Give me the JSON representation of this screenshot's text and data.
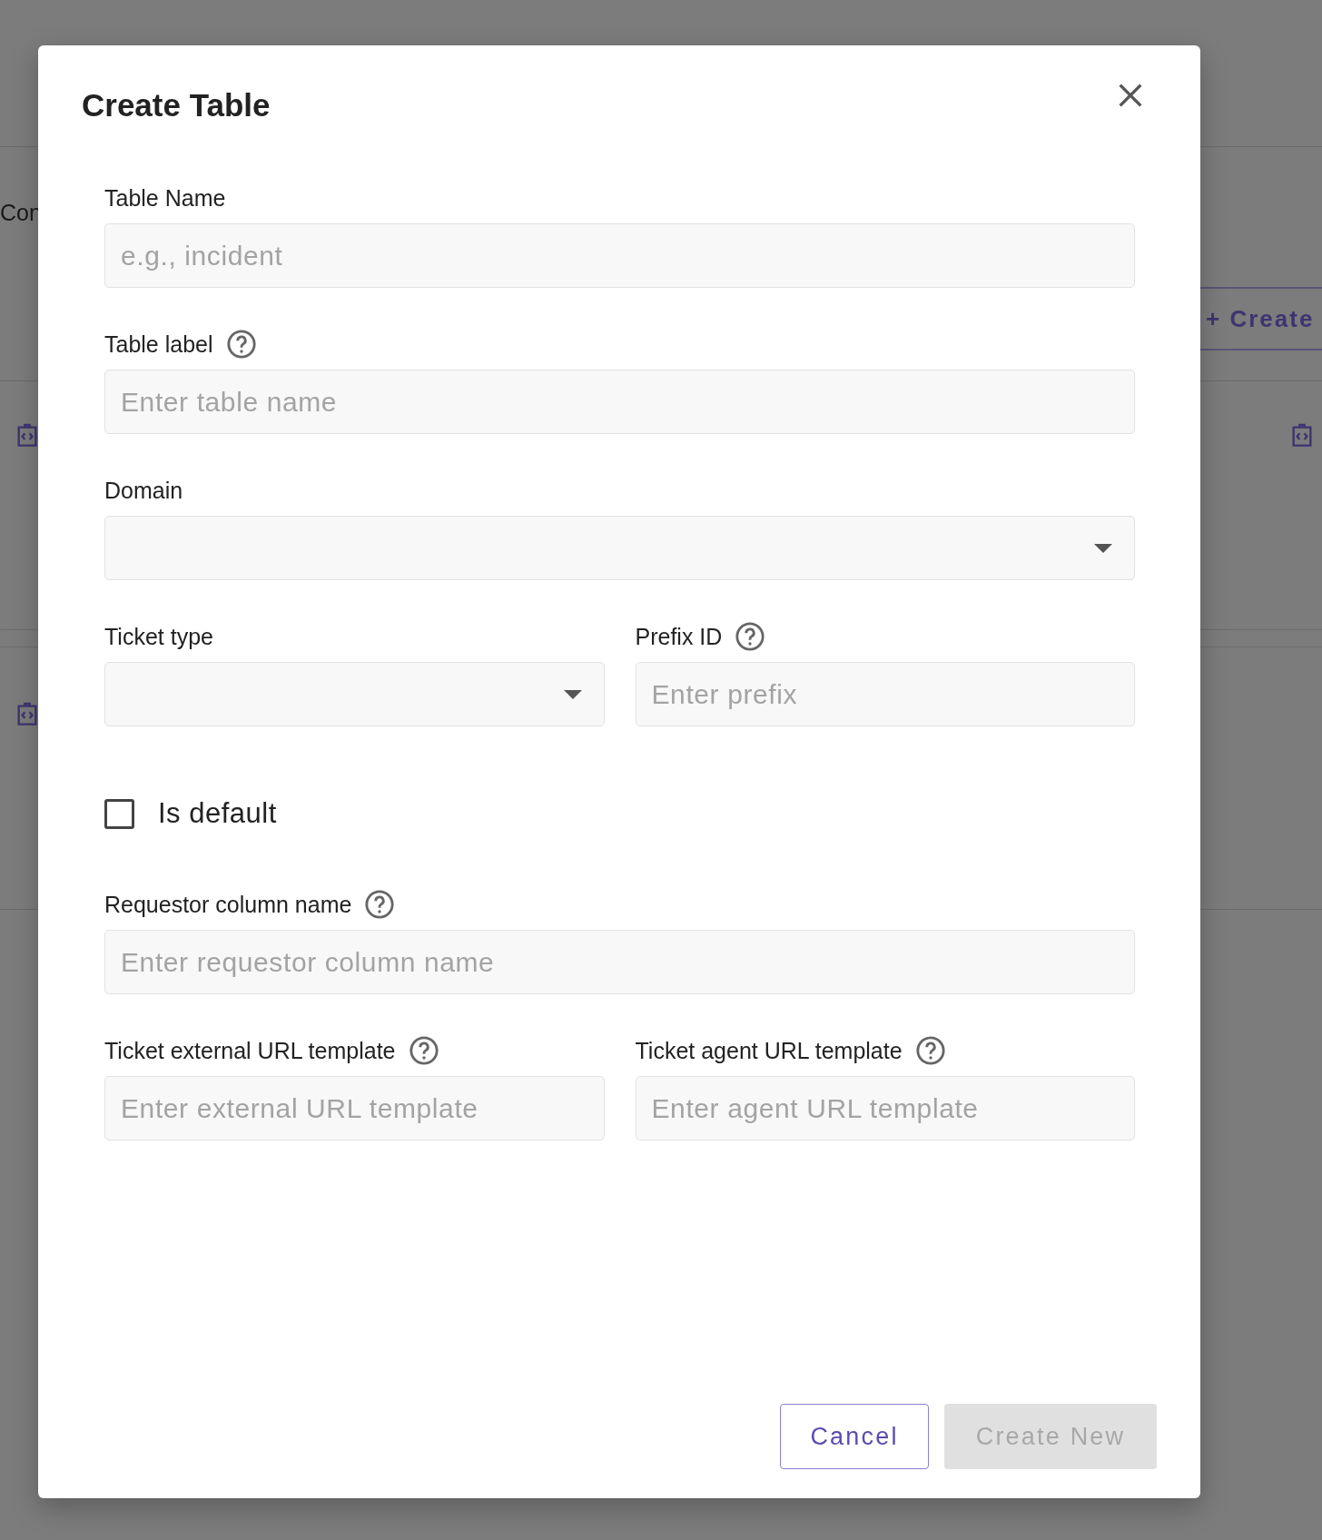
{
  "background": {
    "section_label": "Con",
    "create_button": {
      "icon": "+",
      "label": "Create"
    }
  },
  "dialog": {
    "title": "Create Table",
    "rows": [
      {
        "fields": [
          {
            "kind": "text",
            "label": "Table Name",
            "help": false,
            "placeholder": "e.g., incident"
          }
        ]
      },
      {
        "fields": [
          {
            "kind": "text",
            "label": "Table label",
            "help": true,
            "placeholder": "Enter table name"
          }
        ]
      },
      {
        "fields": [
          {
            "kind": "select",
            "label": "Domain",
            "help": false
          }
        ]
      },
      {
        "fields": [
          {
            "kind": "select",
            "label": "Ticket type",
            "help": false
          },
          {
            "kind": "text",
            "label": "Prefix ID",
            "help": true,
            "placeholder": "Enter prefix"
          }
        ]
      },
      {
        "fields": [
          {
            "kind": "checkbox",
            "label": "Is default",
            "checked": false
          }
        ]
      },
      {
        "fields": [
          {
            "kind": "text",
            "label": "Requestor column name",
            "help": true,
            "placeholder": "Enter requestor column name"
          }
        ]
      },
      {
        "fields": [
          {
            "kind": "text",
            "label": "Ticket external URL template",
            "help": true,
            "placeholder": "Enter external URL template"
          },
          {
            "kind": "text",
            "label": "Ticket agent URL template",
            "help": true,
            "placeholder": "Enter agent URL template"
          }
        ]
      }
    ],
    "buttons": [
      {
        "kind": "outline",
        "label": "Cancel",
        "disabled": false
      },
      {
        "kind": "primary",
        "label": "Create New",
        "disabled": true
      }
    ]
  }
}
